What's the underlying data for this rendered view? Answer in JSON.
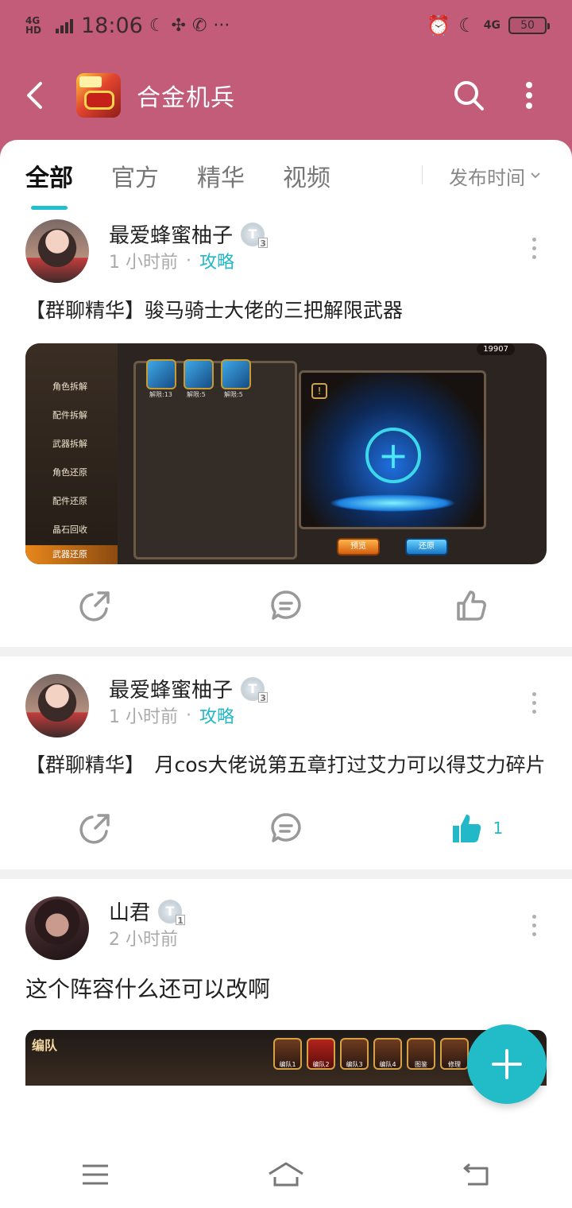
{
  "status_bar": {
    "network": "4G HD",
    "time": "18:06",
    "more": "···",
    "right_net": "4G",
    "battery": "50"
  },
  "header": {
    "title": "合金机兵"
  },
  "tabs": [
    {
      "label": "全部",
      "active": true
    },
    {
      "label": "官方",
      "active": false
    },
    {
      "label": "精华",
      "active": false
    },
    {
      "label": "视频",
      "active": false
    }
  ],
  "sort_label": "发布时间",
  "posts": [
    {
      "author": "最爱蜂蜜柚子",
      "badge": "T",
      "badge_level": "3",
      "time": "1 小时前",
      "dot": "·",
      "tag": "攻略",
      "title": "【群聊精华】骏马骑士大佬的三把解限武器",
      "image": {
        "menu": [
          "角色拆解",
          "配件拆解",
          "武器拆解",
          "角色还原",
          "配件还原",
          "晶石回收",
          "武器还原"
        ],
        "active_menu": "武器还原",
        "slots": [
          "解限:13",
          "解限:5",
          "解限:5"
        ],
        "currency": "19907",
        "btn_preview": "预览",
        "btn_restore": "还原"
      },
      "like_count": ""
    },
    {
      "author": "最爱蜂蜜柚子",
      "badge": "T",
      "badge_level": "3",
      "time": "1 小时前",
      "dot": "·",
      "tag": "攻略",
      "title": "【群聊精华】　月cos大佬说第五章打过艾力可以得艾力碎片",
      "like_count": "1"
    },
    {
      "author": "山君",
      "badge": "T",
      "badge_level": "1",
      "time": "2 小时前",
      "title": "这个阵容什么还可以改啊",
      "image": {
        "header": "编队",
        "chips": [
          "编队1",
          "编队2",
          "编队3",
          "编队4",
          "图鉴",
          "修理"
        ]
      }
    }
  ],
  "colors": {
    "brand": "#c25c79",
    "accent": "#22bcc9"
  }
}
